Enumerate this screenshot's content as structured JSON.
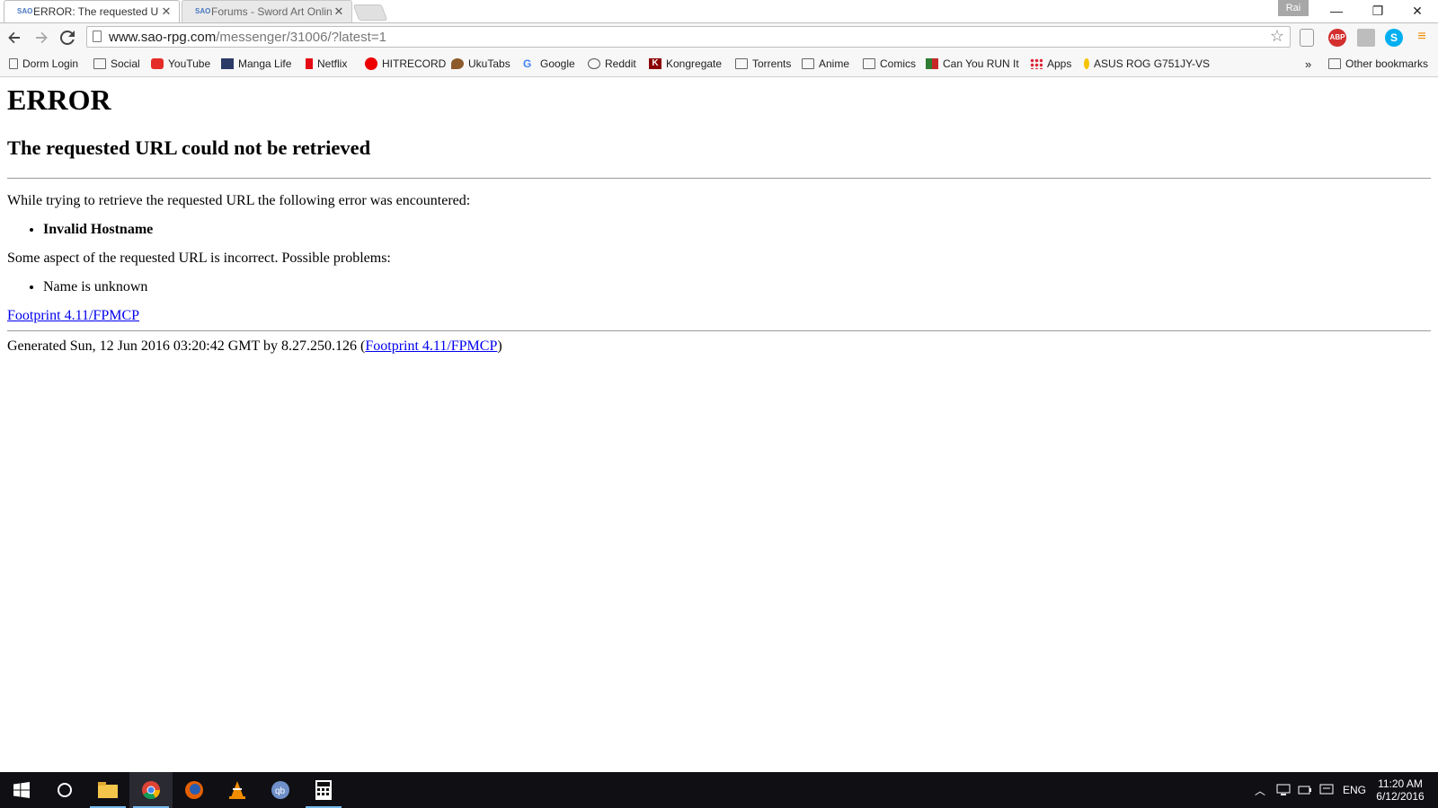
{
  "tabs": [
    {
      "label": "ERROR: The requested URL could not be retrieved",
      "favicon": "SAO",
      "active": true
    },
    {
      "label": "Forums - Sword Art Online",
      "favicon": "SAO",
      "active": false
    }
  ],
  "user_badge": "Rai",
  "window_controls": {
    "minimize": "—",
    "restore": "❐",
    "close": "✕"
  },
  "toolbar": {
    "url_host": "www.sao-rpg.com",
    "url_path": "/messenger/31006/?latest=1",
    "extensions": [
      "ABP"
    ]
  },
  "bookmarks": [
    {
      "label": "Dorm Login",
      "icon": "page-icon"
    },
    {
      "label": "Social",
      "icon": "folder-icon"
    },
    {
      "label": "YouTube",
      "icon": "youtube-icon"
    },
    {
      "label": "Manga Life",
      "icon": "manga-life-icon"
    },
    {
      "label": "Netflix",
      "icon": "netflix-icon"
    },
    {
      "label": "HITRECORD",
      "icon": "hitrecord-icon"
    },
    {
      "label": "UkuTabs",
      "icon": "ukulele-icon"
    },
    {
      "label": "Google",
      "icon": "google-icon"
    },
    {
      "label": "Reddit",
      "icon": "reddit-icon"
    },
    {
      "label": "Kongregate",
      "icon": "kongregate-icon"
    },
    {
      "label": "Torrents",
      "icon": "folder-icon"
    },
    {
      "label": "Anime",
      "icon": "folder-icon"
    },
    {
      "label": "Comics",
      "icon": "folder-icon"
    },
    {
      "label": "Can You RUN It",
      "icon": "canyourunit-icon"
    },
    {
      "label": "Apps",
      "icon": "apps-grid-icon"
    },
    {
      "label": "ASUS ROG G751JY-VS",
      "icon": "asus-icon"
    }
  ],
  "bookmarks_overflow": "»",
  "other_bookmarks": "Other bookmarks",
  "page": {
    "h1": "ERROR",
    "h2": "The requested URL could not be retrieved",
    "intro": "While trying to retrieve the requested URL the following error was encountered:",
    "error_item": "Invalid Hostname",
    "problems_intro": "Some aspect of the requested URL is incorrect. Possible problems:",
    "problem_item": "Name is unknown",
    "footer_link": "Footprint 4.11/FPMCP",
    "generated_prefix": "Generated Sun, 12 Jun 2016 03:20:42 GMT by 8.27.250.126 (",
    "generated_link": "Footprint 4.11/FPMCP",
    "generated_suffix": ")"
  },
  "taskbar": {
    "language": "ENG",
    "time": "11:20 AM",
    "date": "6/12/2016"
  }
}
